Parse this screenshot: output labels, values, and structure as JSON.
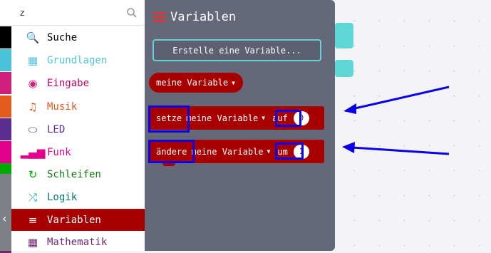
{
  "search": {
    "value": "z",
    "icon": "search-icon"
  },
  "categories": [
    {
      "label": "Suche",
      "color": "#000000",
      "text_color": "#000000",
      "icon": "search-icon",
      "glyph": "🔍"
    },
    {
      "label": "Grundlagen",
      "color": "#4cc3d9",
      "text_color": "#4cc3d9",
      "icon": "grid-icon",
      "glyph": "▦"
    },
    {
      "label": "Eingabe",
      "color": "#d01e7c",
      "text_color": "#c80066",
      "icon": "target-icon",
      "glyph": "◉"
    },
    {
      "label": "Musik",
      "color": "#e35a1c",
      "text_color": "#e35a1c",
      "icon": "headphones-icon",
      "glyph": "♫"
    },
    {
      "label": "LED",
      "color": "#5c2d91",
      "text_color": "#5c2d91",
      "icon": "toggle-icon",
      "glyph": "⬭"
    },
    {
      "label": "Funk",
      "color": "#e3008c",
      "text_color": "#e3008c",
      "icon": "signal-bars-icon",
      "glyph": "▂▄▆"
    },
    {
      "label": "Schleifen",
      "color": "#00aa00",
      "text_color": "#107c10",
      "icon": "loop-icon",
      "glyph": "↻"
    },
    {
      "label": "Logik",
      "color": "#00a4a6",
      "text_color": "#00797a",
      "icon": "shuffle-icon",
      "glyph": "⤮"
    },
    {
      "label": "Variablen",
      "color": "#a80000",
      "text_color": "#ffffff",
      "icon": "list-icon",
      "glyph": "≡",
      "selected": true
    },
    {
      "label": "Mathematik",
      "color": "#712672",
      "text_color": "#712672",
      "icon": "calculator-icon",
      "glyph": "▦"
    }
  ],
  "flyout": {
    "title": "Variablen",
    "create_button": "Erstelle eine Variable...",
    "variable_block": "meine Variable",
    "set_block": {
      "keyword": "setze",
      "variable": "meine Variable",
      "connector": "auf",
      "value": "0"
    },
    "change_block": {
      "keyword": "ändere",
      "variable": "meine Variable",
      "connector": "um",
      "value": "1"
    }
  },
  "colors": {
    "accent": "#a80000",
    "highlight": "#0b00e6",
    "flyout_bg": "#5f6374",
    "button_border": "#5fd6d6"
  }
}
